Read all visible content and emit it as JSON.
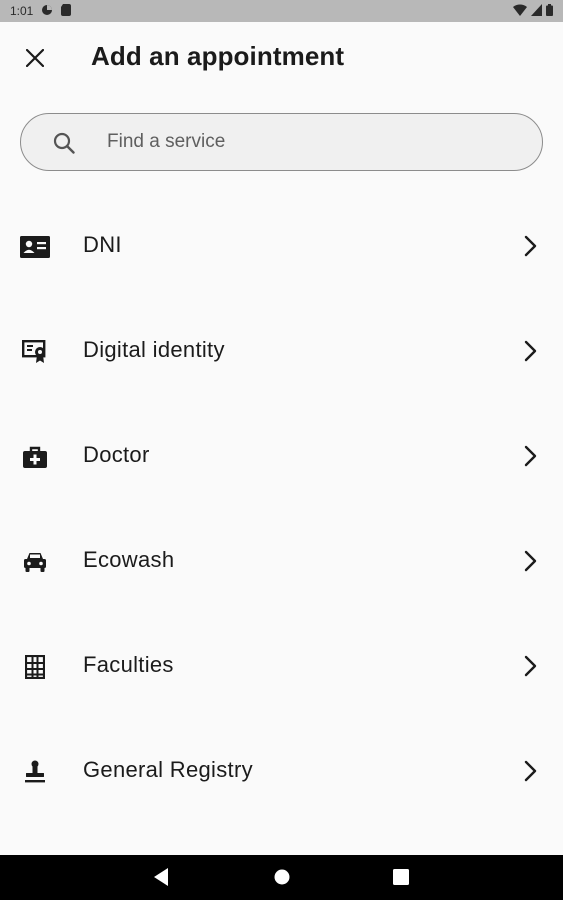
{
  "status_bar": {
    "time": "1:01"
  },
  "header": {
    "title": "Add an appointment"
  },
  "search": {
    "placeholder": "Find a service",
    "value": ""
  },
  "services": [
    {
      "label": "DNI",
      "icon": "id-card-icon"
    },
    {
      "label": "Digital identity",
      "icon": "digital-certificate-icon"
    },
    {
      "label": "Doctor",
      "icon": "medical-bag-icon"
    },
    {
      "label": "Ecowash",
      "icon": "car-icon"
    },
    {
      "label": "Faculties",
      "icon": "building-icon"
    },
    {
      "label": "General Registry",
      "icon": "stamp-icon"
    }
  ]
}
